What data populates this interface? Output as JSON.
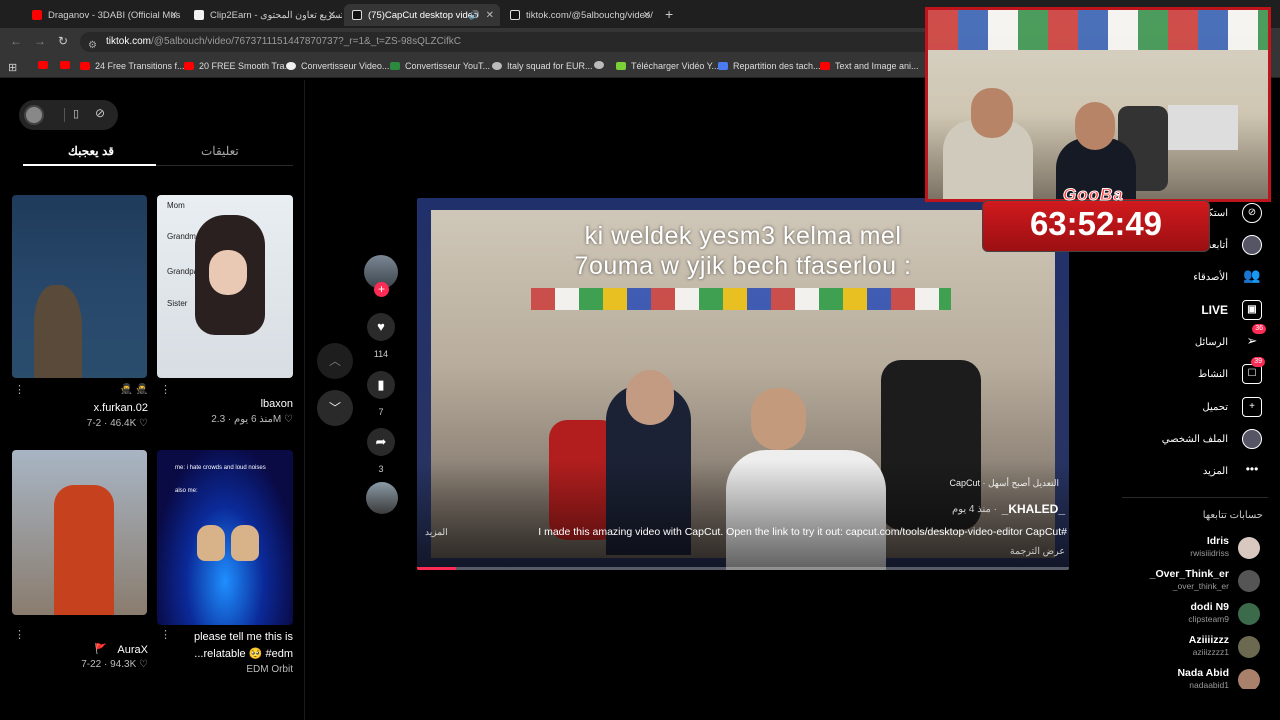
{
  "browser": {
    "tabs": [
      {
        "title": "Draganov - 3DABI (Official Mus",
        "favicon_color": "#ff0000"
      },
      {
        "title": "Clip2Earn - تسريع تعاون المحتوى",
        "favicon_color": "#f2f2f2"
      },
      {
        "title": "(75)CapCut desktop video",
        "favicon_color": "#f2f2f2",
        "active": true
      },
      {
        "title": "tiktok.com/@5albouchg/video/",
        "favicon_color": "#f2f2f2"
      }
    ],
    "url_host": "tiktok.com",
    "url_rest": "/@5albouch/video/7673711151447870737?_r=1&_t=ZS-98sQLZCifkC",
    "bookmarks": [
      {
        "label": "",
        "color": "#ff0000"
      },
      {
        "label": "",
        "color": "#ff0000"
      },
      {
        "label": "24 Free Transitions f...",
        "color": "#ff0000"
      },
      {
        "label": "20 FREE Smooth Tra...",
        "color": "#ff0000"
      },
      {
        "label": "Convertisseur Video...",
        "color": "#f0f0f0"
      },
      {
        "label": "Convertisseur YouT...",
        "color": "#2b8a3e"
      },
      {
        "label": "Italy squad for EUR...",
        "color": "#bbbbbb"
      },
      {
        "label": "",
        "color": "#bbbbbb"
      },
      {
        "label": "Télécharger Vidéo Y...",
        "color": "#7bd035"
      },
      {
        "label": "Repartition des tach...",
        "color": "#4a7cf0"
      },
      {
        "label": "Text and Image ani...",
        "color": "#ff0000"
      }
    ]
  },
  "panel": {
    "tab_comments": "تعليقات",
    "tab_foryou": "قد يعجبك",
    "videos": [
      {
        "user": "x.furkan.02",
        "stats": "7-2 · 46.4K ♡",
        "extra": "🥷 🥷"
      },
      {
        "user": "lbaxon",
        "stats": "منذ 6 يوم · 2.3M ♡",
        "labels": [
          "Mom",
          "Grandma",
          "Grandpa",
          "Sister"
        ]
      },
      {
        "user": "AuraX",
        "stats": "7-22 · 94.3K ♡",
        "extra": "🚩"
      },
      {
        "user": "EDM Orbit",
        "title_line1": "please tell me this is",
        "title_line2": "...relatable 🥺 #edm",
        "caption1": "me: i hate crowds and loud noises",
        "caption2": "also me:"
      }
    ]
  },
  "actions": {
    "likes": "114",
    "saves": "7",
    "shares": "3"
  },
  "video": {
    "caption_line1": "ki weldek yesm3 kelma mel",
    "caption_line2": "7ouma w yjik bech tfaserlou :",
    "capcut_tag": "CapCut · التعديل أصبح أسهل",
    "author": "_KHALED_",
    "time_ago": "منذ 4 يوم ·",
    "description": "I made this amazing video with CapCut. Open the link to try it out: capcut.com/tools/desktop-video-editor CapCut#",
    "more": "المزيد",
    "translate": "عرض الترجمة",
    "progress": 0.06
  },
  "overlay": {
    "brand": "GooBa",
    "timer": "63:52:49",
    "accent": "#c0141c"
  },
  "rightnav": {
    "explore": "استكش",
    "following": "أتابعه",
    "friends": "الأصدقاء",
    "live": "LIVE",
    "messages": "الرسائل",
    "messages_badge": "36",
    "activity": "النشاط",
    "activity_badge": "39",
    "upload": "تحميل",
    "profile": "الملف الشخصي",
    "more": "المزيد",
    "following_accounts_title": "حسابات تتابعها",
    "accounts": [
      {
        "name": "Idris",
        "username": "rwisiiidriss"
      },
      {
        "name": "_Over_Think_er",
        "username": "_over_think_er"
      },
      {
        "name": "dodi N9",
        "username": "clipsteam9"
      },
      {
        "name": "Aziiiizzz",
        "username": "aziiizzzz1"
      },
      {
        "name": "Nada Abid",
        "username": "nadaabid1"
      }
    ]
  }
}
